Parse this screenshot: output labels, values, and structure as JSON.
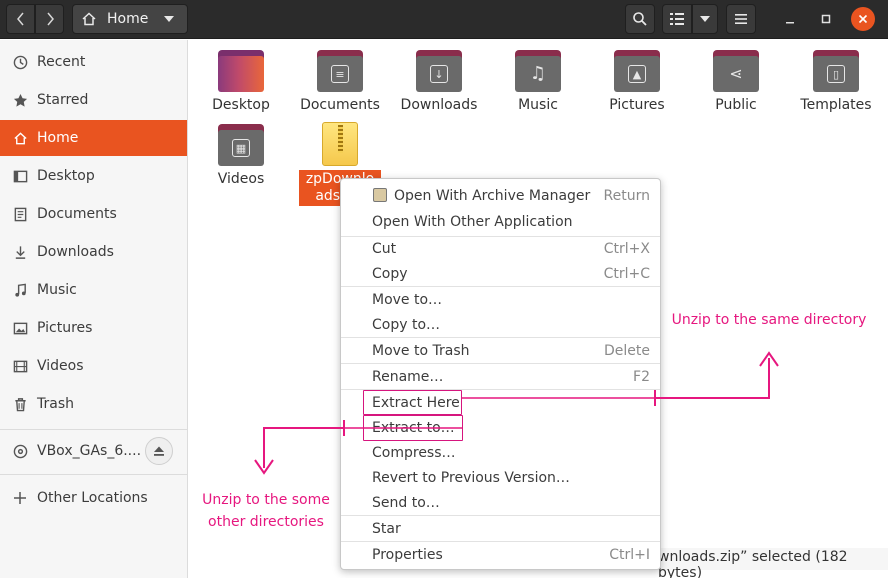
{
  "header": {
    "path_label": "Home"
  },
  "sidebar": {
    "items": [
      {
        "label": "Recent",
        "icon": "clock-icon"
      },
      {
        "label": "Starred",
        "icon": "star-icon"
      },
      {
        "label": "Home",
        "icon": "home-icon",
        "active": true
      },
      {
        "label": "Desktop",
        "icon": "desktop-icon"
      },
      {
        "label": "Documents",
        "icon": "document-icon"
      },
      {
        "label": "Downloads",
        "icon": "download-icon"
      },
      {
        "label": "Music",
        "icon": "music-icon"
      },
      {
        "label": "Pictures",
        "icon": "picture-icon"
      },
      {
        "label": "Videos",
        "icon": "video-icon"
      },
      {
        "label": "Trash",
        "icon": "trash-icon"
      }
    ],
    "device": {
      "label": "VBox_GAs_6....",
      "icon": "disc-icon"
    },
    "other": {
      "label": "Other Locations",
      "icon": "plus-icon"
    }
  },
  "files": [
    {
      "label": "Desktop"
    },
    {
      "label": "Documents"
    },
    {
      "label": "Downloads"
    },
    {
      "label": "Music"
    },
    {
      "label": "Pictures"
    },
    {
      "label": "Public"
    },
    {
      "label": "Templates"
    },
    {
      "label": "Videos"
    }
  ],
  "selected_file": {
    "label": "zpDownloads.zip"
  },
  "status_text": "wnloads.zip” selected  (182 bytes)",
  "context_menu": {
    "items": [
      {
        "label": "Open With Archive Manager",
        "accel": "Return"
      },
      {
        "label": "Open With Other Application",
        "accel": ""
      },
      {
        "label": "Cut",
        "accel": "Ctrl+X"
      },
      {
        "label": "Copy",
        "accel": "Ctrl+C"
      },
      {
        "label": "Move to…",
        "accel": ""
      },
      {
        "label": "Copy to…",
        "accel": ""
      },
      {
        "label": "Move to Trash",
        "accel": "Delete"
      },
      {
        "label": "Rename…",
        "accel": "F2"
      },
      {
        "label": "Extract Here",
        "accel": ""
      },
      {
        "label": "Extract to…",
        "accel": ""
      },
      {
        "label": "Compress…",
        "accel": ""
      },
      {
        "label": "Revert to Previous Version…",
        "accel": ""
      },
      {
        "label": "Send to…",
        "accel": ""
      },
      {
        "label": "Star",
        "accel": ""
      },
      {
        "label": "Properties",
        "accel": "Ctrl+I"
      }
    ]
  },
  "annotations": {
    "same_dir": "Unzip to the same directory",
    "other_dir": "Unzip to the some other directories",
    "color": "#e6177f"
  },
  "colors": {
    "accent": "#e95420",
    "headerbar": "#2b2b2b"
  }
}
